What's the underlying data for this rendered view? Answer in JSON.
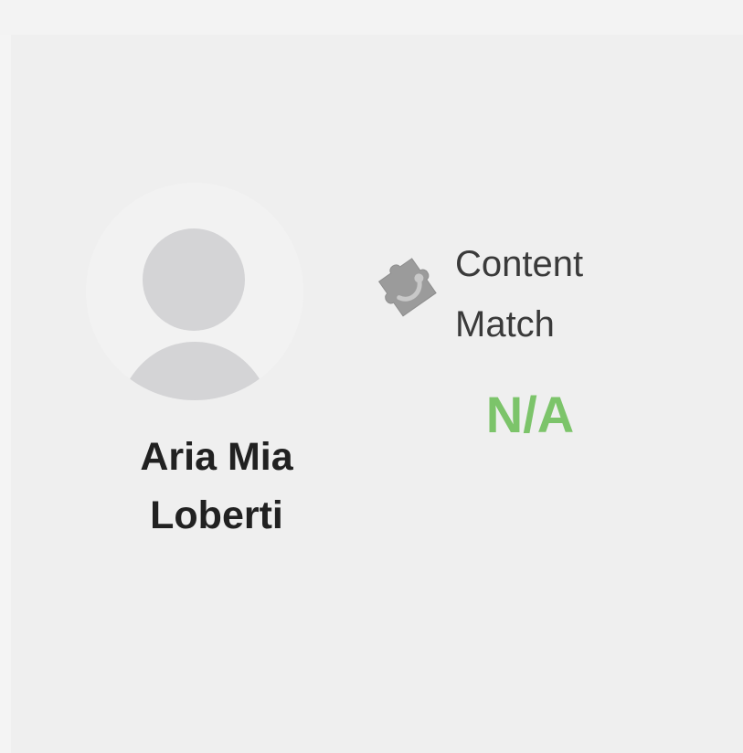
{
  "profile": {
    "name": "Aria Mia Loberti",
    "avatar_icon": "default-user-avatar-icon"
  },
  "metric": {
    "icon": "puzzle-piece-icon",
    "label": "Content Match",
    "value": "N/A"
  },
  "colors": {
    "value_green": "#7cc46a",
    "card_background": "#efefef"
  }
}
